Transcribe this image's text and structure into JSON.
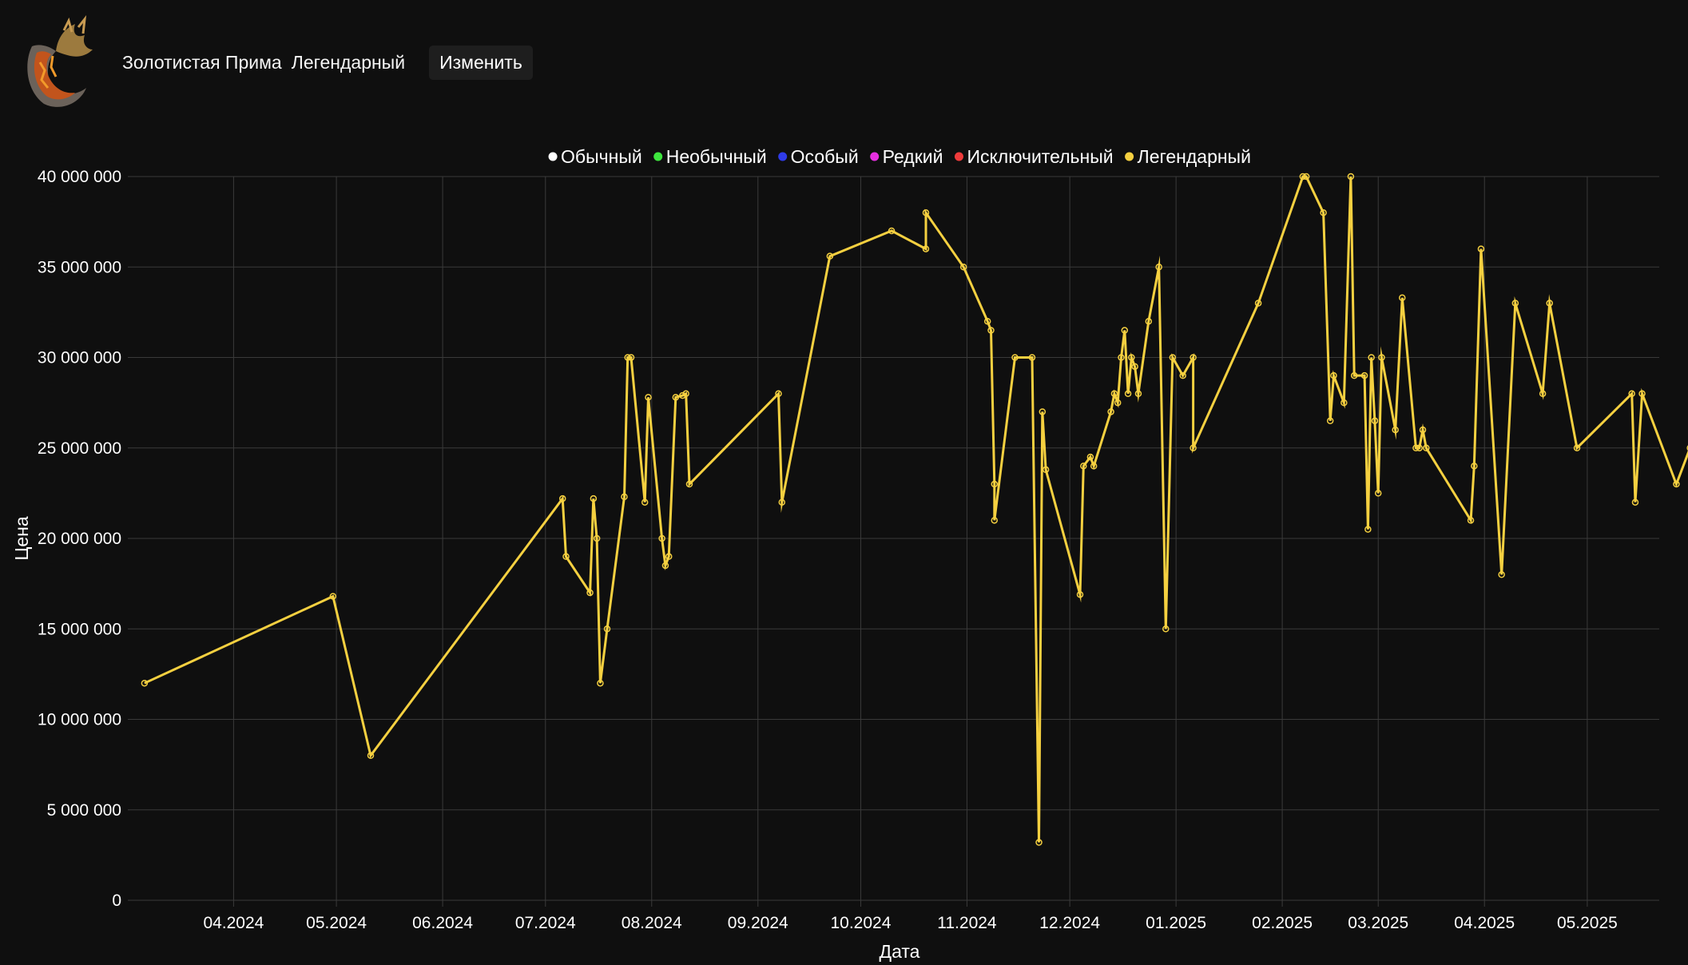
{
  "header": {
    "item_name": "Золотистая Прима",
    "item_rarity": "Легендарный",
    "edit_label": "Изменить",
    "icon": "fossil-item-icon"
  },
  "chart_data": {
    "type": "line",
    "xlabel": "Дата",
    "ylabel": "Цена",
    "ylim": [
      0,
      40000000
    ],
    "yticks": [
      {
        "value": 0,
        "label": "0"
      },
      {
        "value": 5000000,
        "label": "5 000 000"
      },
      {
        "value": 10000000,
        "label": "10 000 000"
      },
      {
        "value": 15000000,
        "label": "15 000 000"
      },
      {
        "value": 20000000,
        "label": "20 000 000"
      },
      {
        "value": 25000000,
        "label": "25 000 000"
      },
      {
        "value": 30000000,
        "label": "30 000 000"
      },
      {
        "value": 35000000,
        "label": "35 000 000"
      },
      {
        "value": 40000000,
        "label": "40 000 000"
      }
    ],
    "xlim": [
      "2024-03-03",
      "2025-05-22"
    ],
    "xticks": [
      {
        "value": "2024-04-01",
        "label": "04.2024"
      },
      {
        "value": "2024-05-01",
        "label": "05.2024"
      },
      {
        "value": "2024-06-01",
        "label": "06.2024"
      },
      {
        "value": "2024-07-01",
        "label": "07.2024"
      },
      {
        "value": "2024-08-01",
        "label": "08.2024"
      },
      {
        "value": "2024-09-01",
        "label": "09.2024"
      },
      {
        "value": "2024-10-01",
        "label": "10.2024"
      },
      {
        "value": "2024-11-01",
        "label": "11.2024"
      },
      {
        "value": "2024-12-01",
        "label": "12.2024"
      },
      {
        "value": "2025-01-01",
        "label": "01.2025"
      },
      {
        "value": "2025-02-01",
        "label": "02.2025"
      },
      {
        "value": "2025-03-01",
        "label": "03.2025"
      },
      {
        "value": "2025-04-01",
        "label": "04.2025"
      },
      {
        "value": "2025-05-01",
        "label": "05.2025"
      }
    ],
    "grid": true,
    "legend_position": "top",
    "legend": [
      {
        "name": "Обычный",
        "color": "#ffffff"
      },
      {
        "name": "Необычный",
        "color": "#3ee63e"
      },
      {
        "name": "Особый",
        "color": "#2f3be8"
      },
      {
        "name": "Редкий",
        "color": "#e62fe0"
      },
      {
        "name": "Исключительный",
        "color": "#ee3b3b"
      },
      {
        "name": "Легендарный",
        "color": "#f5d040"
      }
    ],
    "series": [
      {
        "name": "Легендарный",
        "color": "#f5d040",
        "points": [
          {
            "x": "2024-03-06",
            "y": 12000000
          },
          {
            "x": "2024-04-30",
            "y": 16800000
          },
          {
            "x": "2024-05-11",
            "y": 8000000
          },
          {
            "x": "2024-07-06",
            "y": 22200000
          },
          {
            "x": "2024-07-07",
            "y": 19000000
          },
          {
            "x": "2024-07-14",
            "y": 17000000
          },
          {
            "x": "2024-07-15",
            "y": 22200000
          },
          {
            "x": "2024-07-16",
            "y": 20000000
          },
          {
            "x": "2024-07-17",
            "y": 12000000
          },
          {
            "x": "2024-07-19",
            "y": 15000000
          },
          {
            "x": "2024-07-24",
            "y": 22300000
          },
          {
            "x": "2024-07-25",
            "y": 30000000
          },
          {
            "x": "2024-07-26",
            "y": 30000000
          },
          {
            "x": "2024-07-30",
            "y": 22000000
          },
          {
            "x": "2024-07-31",
            "y": 27800000
          },
          {
            "x": "2024-08-04",
            "y": 20000000
          },
          {
            "x": "2024-08-05",
            "y": 18500000
          },
          {
            "x": "2024-08-06",
            "y": 19000000
          },
          {
            "x": "2024-08-08",
            "y": 27800000
          },
          {
            "x": "2024-08-10",
            "y": 27900000
          },
          {
            "x": "2024-08-11",
            "y": 28000000
          },
          {
            "x": "2024-08-12",
            "y": 23000000
          },
          {
            "x": "2024-09-07",
            "y": 28000000
          },
          {
            "x": "2024-09-08",
            "y": 22000000
          },
          {
            "x": "2024-09-22",
            "y": 35600000
          },
          {
            "x": "2024-10-10",
            "y": 37000000
          },
          {
            "x": "2024-10-20",
            "y": 36000000
          },
          {
            "x": "2024-10-20",
            "y": 38000000
          },
          {
            "x": "2024-10-31",
            "y": 35000000
          },
          {
            "x": "2024-11-07",
            "y": 32000000
          },
          {
            "x": "2024-11-08",
            "y": 31500000
          },
          {
            "x": "2024-11-09",
            "y": 23000000
          },
          {
            "x": "2024-11-09",
            "y": 21000000
          },
          {
            "x": "2024-11-15",
            "y": 30000000
          },
          {
            "x": "2024-11-20",
            "y": 30000000
          },
          {
            "x": "2024-11-22",
            "y": 3200000
          },
          {
            "x": "2024-11-23",
            "y": 27000000
          },
          {
            "x": "2024-11-24",
            "y": 23800000
          },
          {
            "x": "2024-12-04",
            "y": 16900000
          },
          {
            "x": "2024-12-05",
            "y": 24000000
          },
          {
            "x": "2024-12-07",
            "y": 24500000
          },
          {
            "x": "2024-12-08",
            "y": 24000000
          },
          {
            "x": "2024-12-13",
            "y": 27000000
          },
          {
            "x": "2024-12-14",
            "y": 28000000
          },
          {
            "x": "2024-12-15",
            "y": 27500000
          },
          {
            "x": "2024-12-16",
            "y": 30000000
          },
          {
            "x": "2024-12-17",
            "y": 31500000
          },
          {
            "x": "2024-12-18",
            "y": 28000000
          },
          {
            "x": "2024-12-19",
            "y": 30000000
          },
          {
            "x": "2024-12-20",
            "y": 29500000
          },
          {
            "x": "2024-12-21",
            "y": 28000000
          },
          {
            "x": "2024-12-24",
            "y": 32000000
          },
          {
            "x": "2024-12-27",
            "y": 35000000
          },
          {
            "x": "2024-12-29",
            "y": 15000000
          },
          {
            "x": "2024-12-31",
            "y": 30000000
          },
          {
            "x": "2025-01-03",
            "y": 29000000
          },
          {
            "x": "2025-01-06",
            "y": 30000000
          },
          {
            "x": "2025-01-06",
            "y": 25000000
          },
          {
            "x": "2025-01-25",
            "y": 33000000
          },
          {
            "x": "2025-02-07",
            "y": 40000000
          },
          {
            "x": "2025-02-08",
            "y": 40000000
          },
          {
            "x": "2025-02-13",
            "y": 38000000
          },
          {
            "x": "2025-02-15",
            "y": 26500000
          },
          {
            "x": "2025-02-16",
            "y": 29000000
          },
          {
            "x": "2025-02-19",
            "y": 27500000
          },
          {
            "x": "2025-02-21",
            "y": 40000000
          },
          {
            "x": "2025-02-22",
            "y": 29000000
          },
          {
            "x": "2025-02-25",
            "y": 29000000
          },
          {
            "x": "2025-02-26",
            "y": 20500000
          },
          {
            "x": "2025-02-27",
            "y": 30000000
          },
          {
            "x": "2025-02-28",
            "y": 26500000
          },
          {
            "x": "2025-03-01",
            "y": 22500000
          },
          {
            "x": "2025-03-02",
            "y": 30000000
          },
          {
            "x": "2025-03-06",
            "y": 26000000
          },
          {
            "x": "2025-03-08",
            "y": 33300000
          },
          {
            "x": "2025-03-12",
            "y": 25000000
          },
          {
            "x": "2025-03-13",
            "y": 25000000
          },
          {
            "x": "2025-03-14",
            "y": 26000000
          },
          {
            "x": "2025-03-15",
            "y": 25000000
          },
          {
            "x": "2025-03-28",
            "y": 21000000
          },
          {
            "x": "2025-03-29",
            "y": 24000000
          },
          {
            "x": "2025-03-31",
            "y": 36000000
          },
          {
            "x": "2025-04-06",
            "y": 18000000
          },
          {
            "x": "2025-04-10",
            "y": 33000000
          },
          {
            "x": "2025-04-18",
            "y": 28000000
          },
          {
            "x": "2025-04-20",
            "y": 33000000
          },
          {
            "x": "2025-04-28",
            "y": 25000000
          },
          {
            "x": "2025-05-14",
            "y": 28000000
          },
          {
            "x": "2025-05-15",
            "y": 22000000
          },
          {
            "x": "2025-05-17",
            "y": 28000000
          },
          {
            "x": "2025-05-27",
            "y": 23000000
          },
          {
            "x": "2025-05-31",
            "y": 25000000
          }
        ]
      }
    ]
  }
}
